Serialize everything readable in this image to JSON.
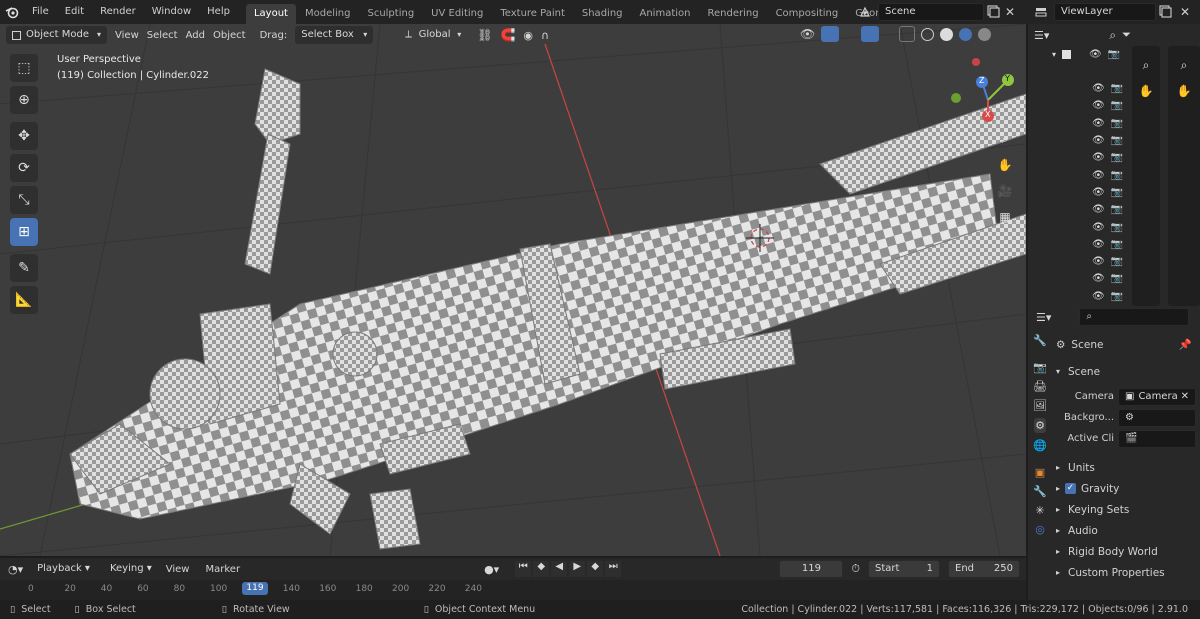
{
  "topbar": {
    "menus": [
      "File",
      "Edit",
      "Render",
      "Window",
      "Help"
    ],
    "workspaces": [
      "Layout",
      "Modeling",
      "Sculpting",
      "UV Editing",
      "Texture Paint",
      "Shading",
      "Animation",
      "Rendering",
      "Compositing",
      "Geometry Nod"
    ],
    "active_workspace": "Layout",
    "scene_name": "Scene",
    "view_layer": "ViewLayer"
  },
  "viewport_header": {
    "mode": "Object Mode",
    "menus": [
      "View",
      "Select",
      "Add",
      "Object"
    ],
    "drag_label": "Drag:",
    "select_tool": "Select Box",
    "orientation": "Global"
  },
  "viewport": {
    "perspective": "User Perspective",
    "collection_info": "(119) Collection | Cylinder.022",
    "gizmo_axes": [
      "Z",
      "Y",
      "X"
    ]
  },
  "properties": {
    "scene_label": "Scene",
    "panel_title": "Scene",
    "camera_label": "Camera",
    "camera_value": "Camera",
    "background_label": "Backgro...",
    "active_clip_label": "Active Cli",
    "sections": [
      "Units",
      "Gravity",
      "Keying Sets",
      "Audio",
      "Rigid Body World",
      "Custom Properties"
    ]
  },
  "timeline": {
    "menus": [
      "Playback",
      "Keying",
      "View",
      "Marker"
    ],
    "current_frame": "119",
    "start_label": "Start",
    "start_value": "1",
    "end_label": "End",
    "end_value": "250",
    "ruler": [
      "0",
      "20",
      "40",
      "60",
      "80",
      "100",
      "119",
      "140",
      "160",
      "180",
      "200",
      "220",
      "240"
    ]
  },
  "statusbar": {
    "select": "Select",
    "box_select": "Box Select",
    "rotate": "Rotate View",
    "context_menu": "Object Context Menu",
    "stats": "Collection | Cylinder.022 | Verts:117,581 | Faces:116,326 | Tris:229,172 | Objects:0/96 | 2.91.0"
  },
  "colors": {
    "accent": "#4772b3",
    "viewport_bg": "#3d3d3d",
    "panel_bg": "#282828",
    "x_axis": "#d94a4a",
    "y_axis": "#8fc63e",
    "z_axis": "#4a7fd9"
  }
}
